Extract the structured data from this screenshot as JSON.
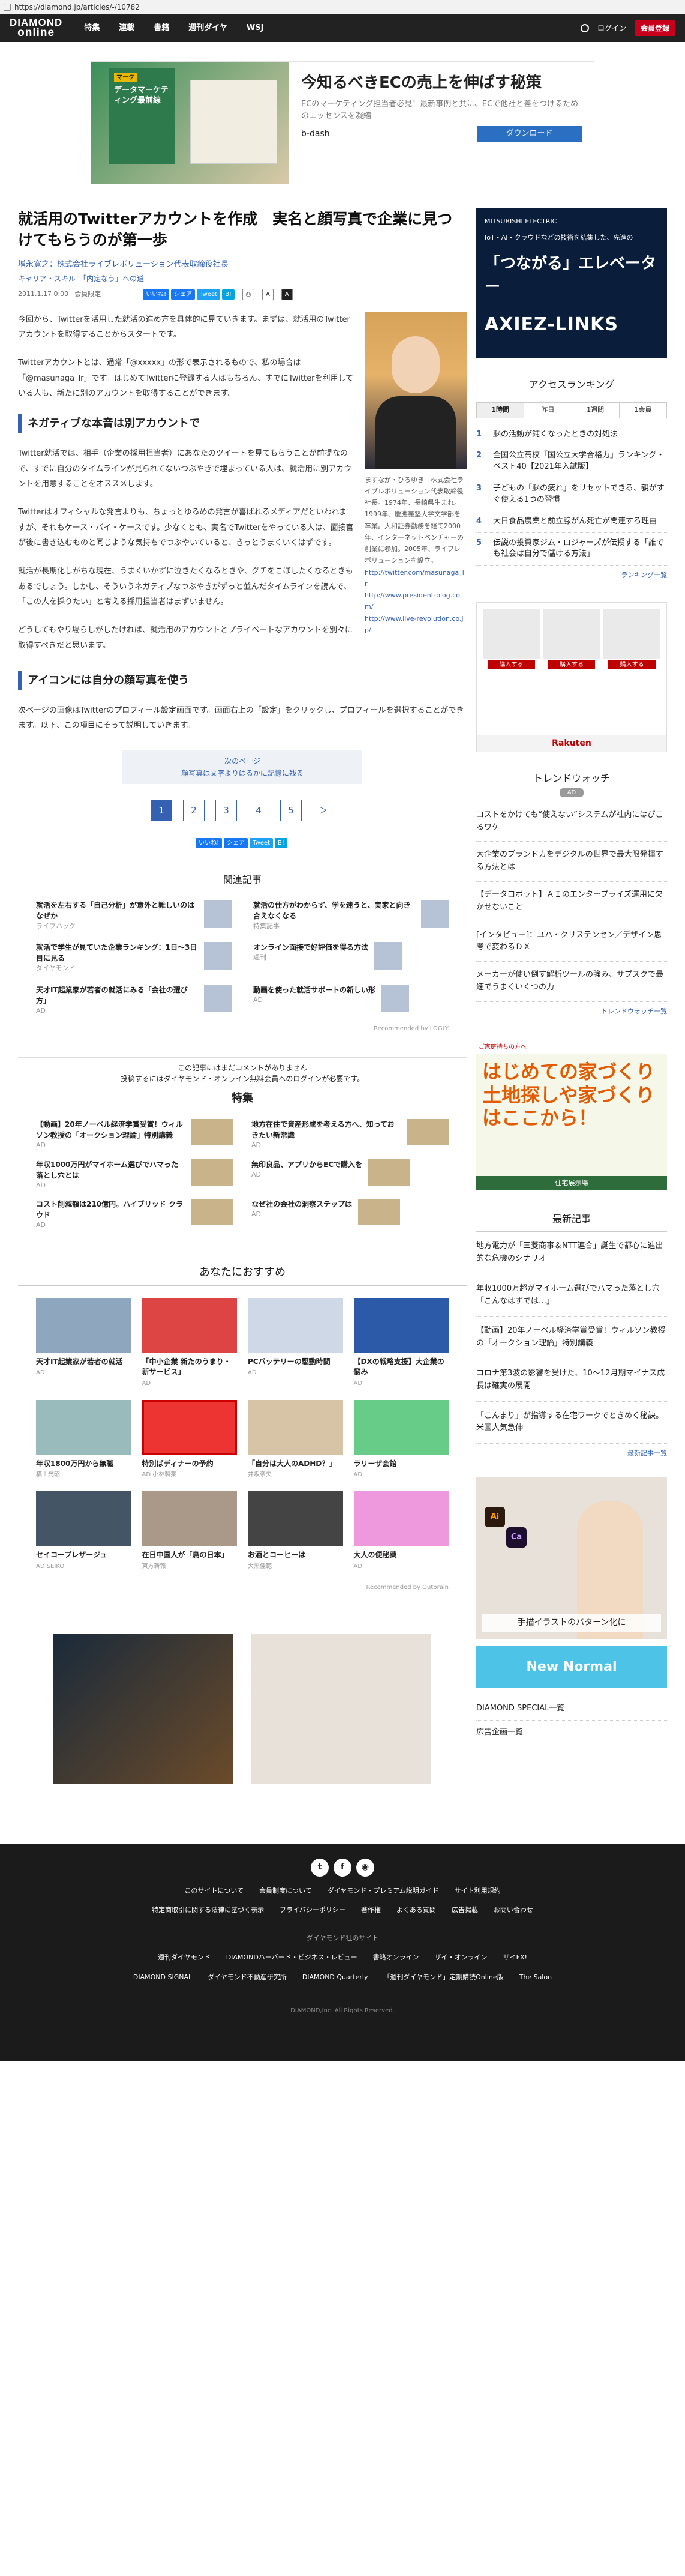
{
  "browser": {
    "url": "https://diamond.jp/articles/-/10782"
  },
  "header": {
    "logo_top": "DIAMOND",
    "logo_bottom": "online",
    "nav": [
      "特集",
      "連載",
      "書籍",
      "週刊ダイヤ",
      "WSJ"
    ],
    "login": "ログイン",
    "register": "会員登録"
  },
  "top_ad": {
    "book_tag": "マーク",
    "book_title": "データマーケティング最前線",
    "headline": "今知るべきECの売上を伸ばす秘策",
    "desc": "ECのマーケティング担当者必見！最新事例と共に、ECで他社と差をつけるためのエッセンスを凝縮",
    "brand": "b-dash",
    "cta": "ダウンロード"
  },
  "article": {
    "title": "就活用のTwitterアカウントを作成　実名と顔写真で企業に見つけてもらうのが第一歩",
    "author_prefix": "",
    "author": "増永寛之：株式会社ライブレボリューション代表取締役社長",
    "tags_label": "キャリア・スキル",
    "tag": "「内定なう」への道",
    "date": "2011.1.17 0:00",
    "count": "会員限定",
    "p1": "今回から、Twitterを活用した就活の進め方を具体的に見ていきます。まずは、就活用のTwitterアカウントを取得することからスタートです。",
    "p2": "Twitterアカウントとは、通常「@xxxxx」の形で表示されるもので、私の場合は「@masunaga_lr」です。はじめてTwitterに登録する人はもちろん、すでにTwitterを利用している人も、新たに別のアカウントを取得することができます。",
    "h_neg": "ネガティブな本音は別アカウントで",
    "p3": "Twitter就活では、相手（企業の採用担当者）にあなたのツイートを見てもらうことが前提なので、すでに自分のタイムラインが見られてないつぶやきで埋まっている人は、就活用に別アカウントを用意することをオススメします。",
    "p4": "Twitterはオフィシャルな発言よりも、ちょっとゆるめの発言が喜ばれるメディアだといわれますが、それもケース・バイ・ケースです。少なくとも、実名でTwitterをやっている人は、面接官が後に書き込むものと同じような気持ちでつぶやいていると、きっとうまくいくはずです。",
    "p5": "就活が長期化しがちな現在、うまくいかずに泣きたくなるときや、グチをこぼしたくなるときもあるでしょう。しかし、そういうネガティブなつぶやきがずっと並んだタイムラインを読んで、「この人を採りたい」と考える採用担当者はまずいません。",
    "p6": "どうしてもやり場らしがしたければ、就活用のアカウントとプライベートなアカウントを別々に取得すべきだと思います。",
    "h_icon": "アイコンには自分の顔写真を使う",
    "p7": "次ページの画像はTwitterのプロフィール設定画面です。画面右上の「設定」をクリックし、プロフィールを選択することができます。以下、この項目にそって説明していきます。",
    "photo_caption": "ますなが・ひろゆき　株式会社ライブレボリューション代表取締役社長。1974年、長崎県生まれ。1999年、慶應義塾大学文学部を卒業。大和証券勤務を経て2000年、インターネットベンチャーの創業に参加。2005年、ライブレボリューションを設立。",
    "photo_caption_links": [
      "http://twitter.com/masunaga_lr",
      "http://www.president-blog.com/",
      "http://www.live-revolution.co.jp/"
    ],
    "next_label": "次のページ",
    "next_title": "顔写真は文字よりはるかに記憶に残る",
    "pages": [
      "1",
      "2",
      "3",
      "4",
      "5"
    ],
    "next_arrow": "＞"
  },
  "share": {
    "fb": "いいね!",
    "share": "シェア",
    "tw": "Tweet",
    "hb": "B!"
  },
  "related": {
    "heading": "関連記事",
    "items": [
      {
        "title": "就活を左右する「自己分析」が意外と難しいのはなぜか",
        "src": "ライフハック"
      },
      {
        "title": "就活の仕方がわからず、学を迷うと、実家と向き合えなくなる",
        "src": "特集記事"
      },
      {
        "title": "就活で学生が見ていた企業ランキング：1日〜3日目に見る",
        "src": "ダイヤモンド"
      },
      {
        "title": "オンライン面接で好評価を得る方法",
        "src": "週刊"
      },
      {
        "title": "天才IT起業家が若者の就活にみる「会社の選び方」",
        "src": "AD"
      },
      {
        "title": "動画を使った就活サポートの新しい形",
        "src": "AD"
      }
    ],
    "recommended": "Recommended by LOGLY"
  },
  "comment": {
    "line1": "この記事にはまだコメントがありません",
    "line2": "投稿するにはダイヤモンド・オンライン無料会員へのログインが必要です。"
  },
  "features": {
    "heading": "特集",
    "items": [
      {
        "title": "【動画】20年ノーベル経済学賞受賞！ウィルソン教授の「オークション理論」特別講義",
        "src": "AD"
      },
      {
        "title": "地方在住で資産形成を考える方へ、知っておきたい新常識",
        "src": "AD"
      },
      {
        "title": "年収1000万円がマイホーム選びでハマった落とし穴とは",
        "src": "AD"
      },
      {
        "title": "無印良品、アプリからECで購入を",
        "src": "AD"
      },
      {
        "title": "コスト削減額は210億円。ハイブリッド クラウド",
        "src": "AD"
      },
      {
        "title": "なぜ社の会社の洞察ステップは",
        "src": "AD"
      }
    ]
  },
  "rec": {
    "heading": "あなたにおすすめ",
    "items": [
      {
        "title": "天才IT起業家が若者の就活",
        "src": "AD"
      },
      {
        "title": "「中小企業 新たのうまり・新サービス」",
        "src": "AD"
      },
      {
        "title": "PCバッテリーの駆動時間",
        "src": "AD"
      },
      {
        "title": "【DXの戦略支援】大企業の悩み",
        "src": "AD"
      },
      {
        "title": "年収1800万円から無職",
        "src": "横山光昭"
      },
      {
        "title": "特別ばディナーの予約",
        "src": "AD 小林製薬"
      },
      {
        "title": "「自分は大人のADHD？」",
        "src": "井坂奈央"
      },
      {
        "title": "ラリーザ会館",
        "src": "AD"
      },
      {
        "title": "セイコープレザージュ",
        "src": "AD SEIKO"
      },
      {
        "title": "在日中国人が「鳥の日本」",
        "src": "東方新報"
      },
      {
        "title": "お酒とコーヒーは",
        "src": "大黒佳範"
      },
      {
        "title": "大人の便秘薬",
        "src": "AD"
      }
    ],
    "ob": "Recommended by Outbrain"
  },
  "side": {
    "ad1": {
      "maker": "MITSUBISHI ELECTRIC",
      "cat": "IoT・AI・クラウドなどの技術を結集した、先進の",
      "big": "「つながる」エレベーター",
      "name": "AXIEZ-LINKS"
    },
    "ranking": {
      "heading": "アクセスランキング",
      "tabs": [
        "1時間",
        "昨日",
        "1週間",
        "1会員"
      ],
      "items": [
        "脳の活動が鈍くなったときの対処法",
        "全国公立高校「国公立大学合格力」ランキング・ベスト40【2021年入試版】",
        "子どもの「脳の疲れ」をリセットできる、親がすぐ使える1つの習慣",
        "大日食品農業と前立腺がん死亡が関連する理由",
        "伝説の投資家ジム・ロジャーズが伝授する「誰でも社会は自分で儲ける方法」"
      ],
      "more": "ランキング一覧"
    },
    "rakuten": "Rakuten",
    "trends": {
      "heading": "トレンドウォッチ",
      "badge": "AD",
      "items": [
        "コストをかけても“使えない”システムが社内にはびこるワケ",
        "大企業のブランドカをデジタルの世界で最大限発揮する方法とは",
        "【データロボット】ＡＩのエンタープライズ運用に欠かせないこと",
        "[インタビュー]：ユハ・クリステンセン／デザイン思考で変わるＤＸ",
        "メーカーが使い倒す解析ツールの強み、サプスクで最速でうまくいくつの力"
      ],
      "more": "トレンドウォッチ一覧"
    },
    "house_ad": {
      "head": "ご家庭持ちの方へ",
      "big": "はじめての家づくり土地探しや家づくりはここから！",
      "foot": "住宅展示場"
    },
    "latest": {
      "heading": "最新記事",
      "items": [
        "地方電力が「三菱商事＆NTT連合」誕生で都心に進出的な危機のシナリオ",
        "年収1000万超がマイホーム選びでハマった落とし穴「こんなはずでは…」",
        "【動画】20年ノーベル経済学賞受賞！ウィルソン教授の「オークション理論」特別講義",
        "コロナ第3波の影響を受けた、10〜12月期マイナス成長は確実の展開",
        "「こんまり」が指導する在宅ワークでときめく秘訣。米国人気急伸"
      ],
      "more": "最新記事一覧"
    },
    "special": "DIAMOND SPECIAL一覧",
    "adlist": "広告企画一覧",
    "wom_caption": "手描イラストのパターン化に",
    "nn": "New Normal"
  },
  "footer": {
    "links": [
      "このサイトについて",
      "会員制度について",
      "ダイヤモンド・プレミアム説明ガイド",
      "サイト利用規約",
      "特定商取引に関する法律に基づく表示",
      "プライバシーポリシー",
      "著作権",
      "よくある質問",
      "広告掲載",
      "お問い合わせ"
    ],
    "sites_label": "ダイヤモンド社のサイト",
    "sites": [
      "週刊ダイヤモンド",
      "DIAMONDハーバード・ビジネス・レビュー",
      "書籍オンライン",
      "ザイ・オンライン",
      "ザイFX!",
      "DIAMOND SIGNAL",
      "ダイヤモンド不動産研究所",
      "DIAMOND Quarterly",
      "「週刊ダイヤモンド」定期購読Online版",
      "The Salon"
    ],
    "copy": "DIAMOND,Inc. All Rights Reserved."
  }
}
